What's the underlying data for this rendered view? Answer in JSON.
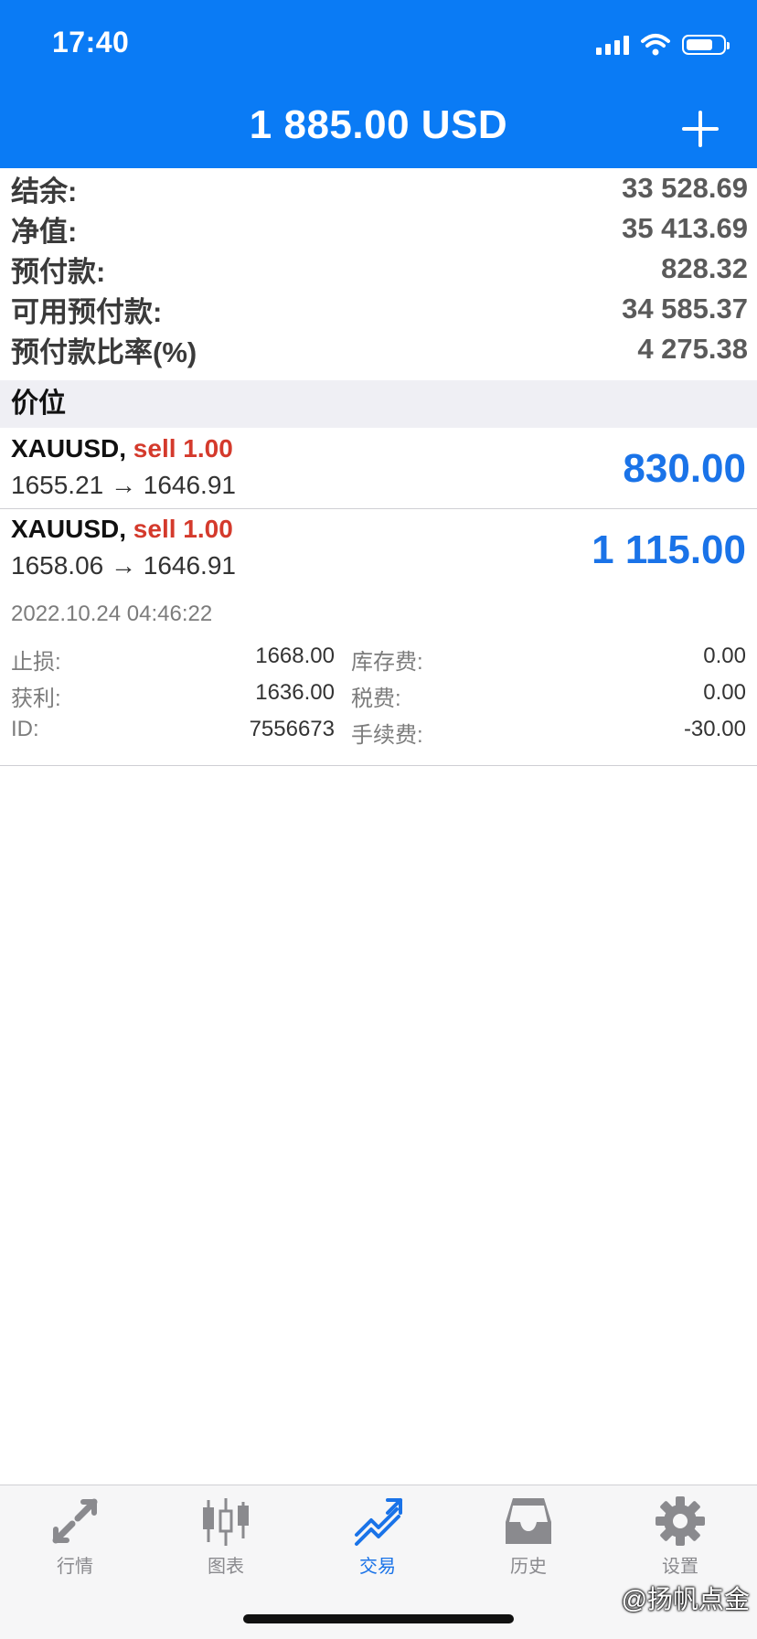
{
  "status_bar": {
    "time": "17:40"
  },
  "header": {
    "title": "1 885.00 USD"
  },
  "account": [
    {
      "label": "结余:",
      "value": "33 528.69"
    },
    {
      "label": "净值:",
      "value": "35 413.69"
    },
    {
      "label": "预付款:",
      "value": "828.32"
    },
    {
      "label": "可用预付款:",
      "value": "34 585.37"
    },
    {
      "label": "预付款比率(%)",
      "value": "4 275.38"
    }
  ],
  "section_label": "价位",
  "positions": [
    {
      "symbol": "XAUUSD,",
      "side": "sell 1.00",
      "prices": "1655.21 → 1646.91",
      "profit": "830.00"
    },
    {
      "symbol": "XAUUSD,",
      "side": "sell 1.00",
      "prices": "1658.06 → 1646.91",
      "profit": "1 115.00"
    }
  ],
  "details": {
    "datetime": "2022.10.24 04:46:22",
    "rows": [
      {
        "label1": "止损:",
        "value1": "1668.00",
        "label2": "库存费:",
        "value2": "0.00"
      },
      {
        "label1": "获利:",
        "value1": "1636.00",
        "label2": "税费:",
        "value2": "0.00"
      },
      {
        "label1": "ID:",
        "value1": "7556673",
        "label2": "手续费:",
        "value2": "-30.00"
      }
    ]
  },
  "tabs": [
    {
      "label": "行情",
      "icon": "quotes-icon"
    },
    {
      "label": "图表",
      "icon": "chart-candles-icon"
    },
    {
      "label": "交易",
      "icon": "trade-icon",
      "active": true
    },
    {
      "label": "历史",
      "icon": "history-inbox-icon"
    },
    {
      "label": "设置",
      "icon": "settings-gear-icon"
    }
  ],
  "watermark": "@扬帆点金",
  "colors": {
    "header": "#0a7bf5",
    "profit": "#1a73e8",
    "sell": "#d43a2c"
  }
}
